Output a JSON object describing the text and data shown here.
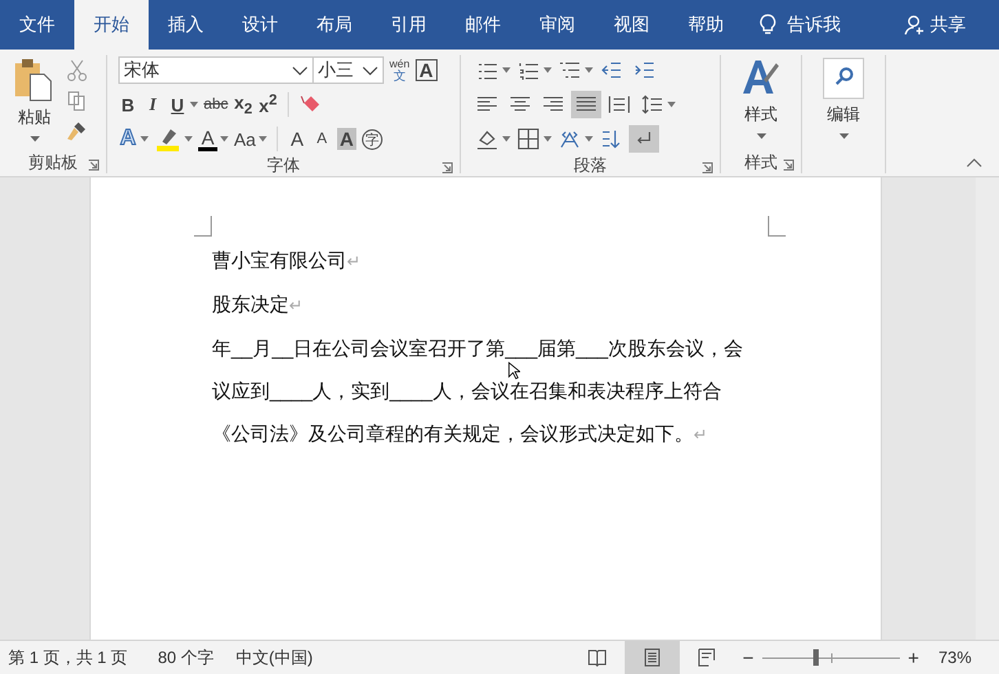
{
  "tabs": [
    {
      "label": "文件",
      "selected": false
    },
    {
      "label": "开始",
      "selected": true
    },
    {
      "label": "插入",
      "selected": false
    },
    {
      "label": "设计",
      "selected": false
    },
    {
      "label": "布局",
      "selected": false
    },
    {
      "label": "引用",
      "selected": false
    },
    {
      "label": "邮件",
      "selected": false
    },
    {
      "label": "审阅",
      "selected": false
    },
    {
      "label": "视图",
      "selected": false
    },
    {
      "label": "帮助",
      "selected": false
    }
  ],
  "tell_me": "告诉我",
  "share": "共享",
  "clipboard": {
    "paste": "粘贴",
    "label": "剪贴板"
  },
  "font": {
    "label": "字体",
    "name": "宋体",
    "size": "小三",
    "phonetic_top": "wén",
    "phonetic_bottom": "文",
    "border_char": "A",
    "row2": [
      {
        "kind": "bold",
        "text": "B",
        "caret": false
      },
      {
        "kind": "italic",
        "text": "I",
        "caret": false
      },
      {
        "kind": "underline",
        "text": "U",
        "caret": true
      },
      {
        "kind": "strike",
        "text": "abc",
        "caret": false
      },
      {
        "kind": "script",
        "text": "x$_{2}$",
        "caret": false
      },
      {
        "kind": "script",
        "text": "x$^{2}$",
        "caret": false
      }
    ],
    "row3": [
      {
        "kind": "effect",
        "text": "A",
        "caret": true
      },
      {
        "kind": "highlight",
        "caret": true
      },
      {
        "kind": "color",
        "text": "A",
        "caret": true
      },
      {
        "kind": "case",
        "text": "Aa",
        "caret": true
      },
      {
        "kind": "grow",
        "text": "A",
        "caret": false
      },
      {
        "kind": "shrink",
        "text": "A",
        "caret": false
      },
      {
        "kind": "shade",
        "text": "A",
        "caret": false
      },
      {
        "kind": "enclose",
        "text": "字",
        "caret": false
      }
    ]
  },
  "paragraph": {
    "label": "段落",
    "rows": [
      [
        {
          "kind": "bullets",
          "caret": true,
          "selected": false
        },
        {
          "kind": "numbering",
          "caret": true,
          "selected": false
        },
        {
          "kind": "multilevel",
          "caret": true,
          "selected": false
        },
        {
          "kind": "outdent",
          "caret": false,
          "selected": false
        },
        {
          "kind": "indent",
          "caret": false,
          "selected": false
        }
      ],
      [
        {
          "kind": "align-left",
          "caret": false,
          "selected": false
        },
        {
          "kind": "center",
          "caret": false,
          "selected": false
        },
        {
          "kind": "align-right",
          "caret": false,
          "selected": false
        },
        {
          "kind": "justify",
          "caret": false,
          "selected": true
        },
        {
          "kind": "distribute",
          "caret": false,
          "selected": false
        },
        {
          "kind": "line-spacing",
          "caret": true,
          "selected": false
        }
      ],
      [
        {
          "kind": "shading",
          "caret": true,
          "selected": false
        },
        {
          "kind": "borders",
          "caret": true,
          "selected": false
        },
        {
          "kind": "chinese-layout",
          "caret": true,
          "selected": false
        },
        {
          "kind": "sort",
          "caret": false,
          "selected": false
        },
        {
          "kind": "show-marks",
          "caret": false,
          "selected": true
        }
      ]
    ]
  },
  "styles": {
    "button": "样式",
    "label": "样式"
  },
  "editing": {
    "button": "编辑"
  },
  "document": {
    "paragraphs": [
      {
        "lines": [
          "曹小宝有限公司"
        ],
        "mark": "↵"
      },
      {
        "lines": [
          "股东决定"
        ],
        "mark": "↵"
      },
      {
        "lines": [
          "年__月__日在公司会议室召开了第___届第___次股东会议，会",
          "议应到____人，实到____人，会议在召集和表决程序上符合",
          "《公司法》及公司章程的有关规定，会议形式决定如下。"
        ],
        "mark": "↵"
      }
    ]
  },
  "status_bar": {
    "page": "第 1 页，共 1 页",
    "words": "80 个字",
    "language": "中文(中国)",
    "views": [
      {
        "kind": "read",
        "selected": false
      },
      {
        "kind": "print",
        "selected": true
      },
      {
        "kind": "web",
        "selected": false
      }
    ],
    "zoom_out": "−",
    "zoom_in": "+",
    "zoom": {
      "level": 0.37
    },
    "zoom_text": "73%"
  }
}
